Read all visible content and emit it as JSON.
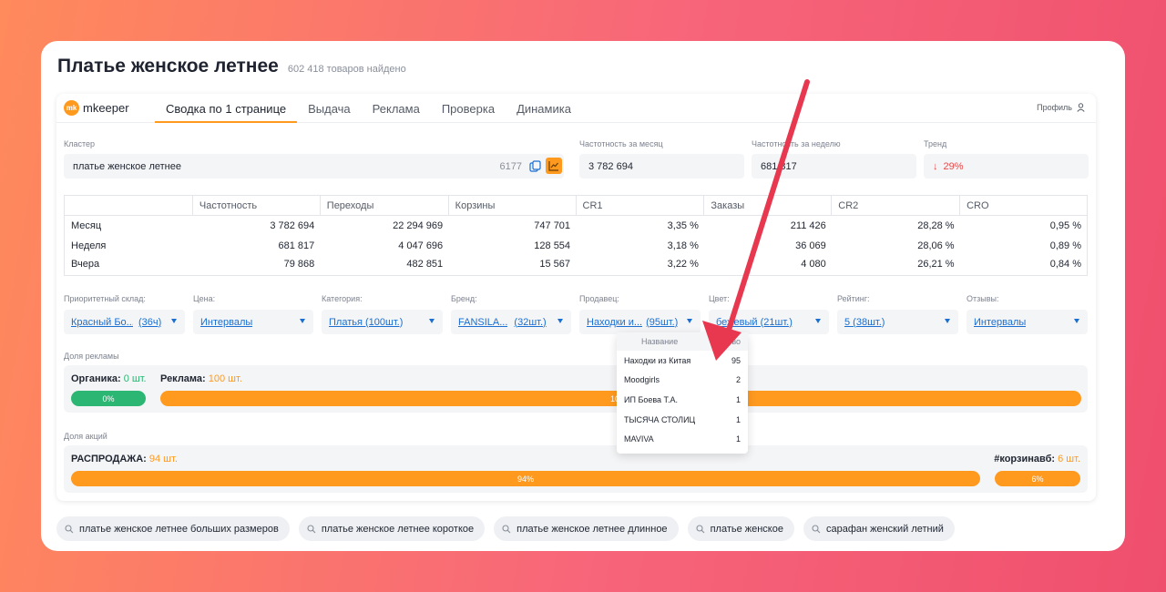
{
  "page": {
    "title": "Платье женское летнее",
    "subtitle": "602 418 товаров найдено"
  },
  "topbar": {
    "logo_mark": "mk",
    "logo_text": "mkeeper",
    "tabs": [
      "Сводка по 1 странице",
      "Выдача",
      "Реклама",
      "Проверка",
      "Динамика"
    ],
    "profile": "Профиль"
  },
  "summary": {
    "cluster_label": "Кластер",
    "cluster_value": "платье женское летнее",
    "cluster_count": "6177",
    "freq_month_label": "Частотность за месяц",
    "freq_month_value": "3 782 694",
    "freq_week_label": "Частотность за неделю",
    "freq_week_value": "681 817",
    "trend_label": "Тренд",
    "trend_value": "29%",
    "trend_color": "#e84a4a"
  },
  "stats": {
    "headers": [
      "",
      "Частотность",
      "Переходы",
      "Корзины",
      "CR1",
      "Заказы",
      "CR2",
      "CRO"
    ],
    "rows": [
      [
        "Месяц",
        "3 782 694",
        "22 294 969",
        "747 701",
        "3,35 %",
        "211 426",
        "28,28 %",
        "0,95 %"
      ],
      [
        "Неделя",
        "681 817",
        "4 047 696",
        "128 554",
        "3,18 %",
        "36 069",
        "28,06 %",
        "0,89 %"
      ],
      [
        "Вчера",
        "79 868",
        "482 851",
        "15 567",
        "3,22 %",
        "4 080",
        "26,21 %",
        "0,84 %"
      ]
    ]
  },
  "filters": {
    "warehouse": {
      "label": "Приоритетный склад:",
      "value": "Красный Бо...",
      "count": "(36ч)"
    },
    "price": {
      "label": "Цена:",
      "value": "Интервалы"
    },
    "category": {
      "label": "Категория:",
      "value": "Платья (100шт.)"
    },
    "brand": {
      "label": "Бренд:",
      "value": "FANSILA...",
      "count": "(32шт.)"
    },
    "seller": {
      "label": "Продавец:",
      "value": "Находки и...",
      "count": "(95шт.)"
    },
    "color": {
      "label": "Цвет:",
      "value": "бежевый (21шт.)"
    },
    "rating": {
      "label": "Рейтинг:",
      "value": "5 (38шт.)"
    },
    "reviews": {
      "label": "Отзывы:",
      "value": "Интервалы"
    }
  },
  "ads": {
    "label": "Доля рекламы",
    "organic_title": "Органика:",
    "organic_count": "0 шт.",
    "organic_pct": "0%",
    "ads_title": "Реклама:",
    "ads_count": "100 шт.",
    "ads_pct": "100%"
  },
  "promos": {
    "label": "Доля акций",
    "sale_title": "РАСПРОДАЖА:",
    "sale_count": "94 шт.",
    "sale_pct": "94%",
    "cart_title": "#корзинавб:",
    "cart_count": "6 шт.",
    "cart_pct": "6%"
  },
  "seller_dropdown": {
    "head_name": "Название",
    "head_qty": "Кол-во",
    "rows": [
      [
        "Находки из Китая",
        "95"
      ],
      [
        "Moodgirls",
        "2"
      ],
      [
        "ИП Боева Т.А.",
        "1"
      ],
      [
        "ТЫСЯЧА СТОЛИЦ",
        "1"
      ],
      [
        "MAVIVA",
        "1"
      ]
    ]
  },
  "suggestions": [
    "платье женское летнее больших размеров",
    "платье женское летнее короткое",
    "платье женское летнее длинное",
    "платье женское",
    "сарафан женский летний"
  ],
  "colors": {
    "accent": "#ff9a1f",
    "link": "#1a6fd1",
    "green": "#2bb673",
    "arrow": "#e8384f"
  }
}
